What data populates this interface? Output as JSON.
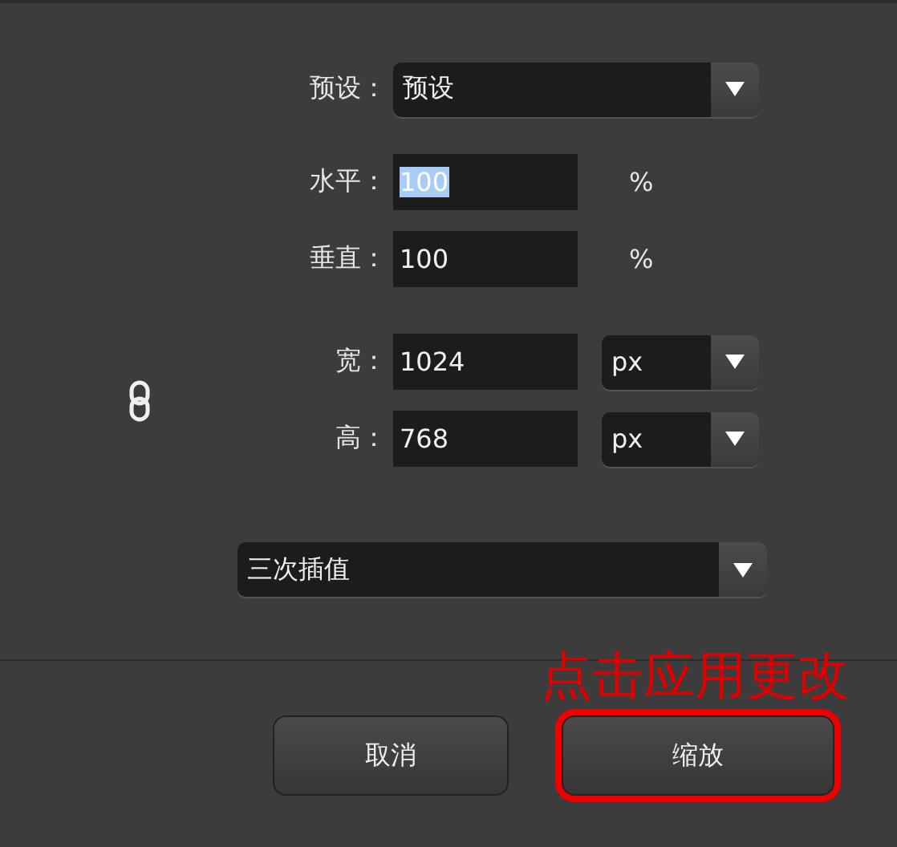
{
  "preset": {
    "label": "预设：",
    "value": "预设"
  },
  "scale": [
    {
      "label": "水平：",
      "value": "100",
      "unit": "%",
      "text_selected": true
    },
    {
      "label": "垂直：",
      "value": "100",
      "unit": "%",
      "text_selected": false
    }
  ],
  "size": {
    "linked": true,
    "fields": [
      {
        "label": "宽：",
        "value": "1024",
        "unit": "px"
      },
      {
        "label": "高：",
        "value": "768",
        "unit": "px"
      }
    ]
  },
  "interpolation": "三次插值",
  "buttons": [
    {
      "label": "取消",
      "highlighted": false
    },
    {
      "label": "缩放",
      "highlighted": true
    }
  ],
  "annotation": "点击应用更改"
}
